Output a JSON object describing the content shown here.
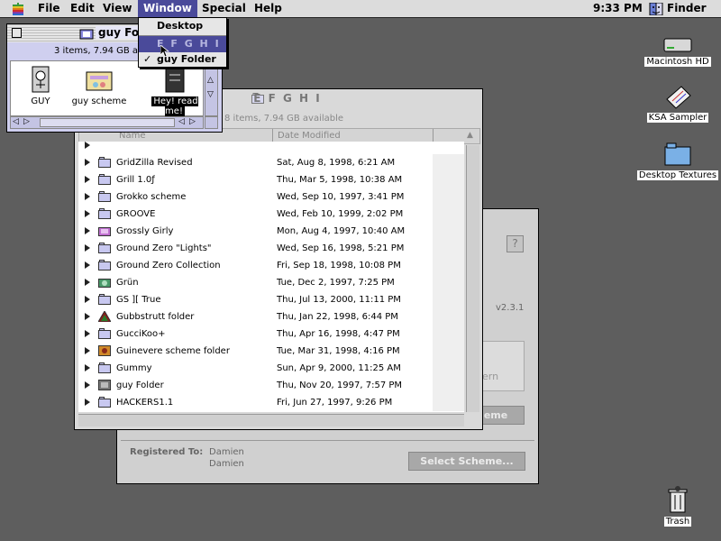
{
  "menubar": {
    "apple": "apple-icon",
    "items": [
      "File",
      "Edit",
      "View",
      "Window",
      "Special",
      "Help"
    ],
    "active": "Window",
    "clock": "9:33 PM",
    "app_name": "Finder"
  },
  "window_menu": {
    "items": [
      {
        "label": "Desktop",
        "checked": false,
        "selected": false
      },
      {
        "label": "E F G H I",
        "checked": false,
        "selected": true
      },
      {
        "label": "guy Folder",
        "checked": true,
        "selected": false
      }
    ],
    "checkmark": "✓"
  },
  "desktop_icons": [
    {
      "label": "Macintosh HD",
      "icon": "hard-drive-icon"
    },
    {
      "label": "KSA Sampler",
      "icon": "document-icon"
    },
    {
      "label": "Desktop Textures",
      "icon": "folder-icon"
    },
    {
      "label": "Trash",
      "icon": "trash-icon"
    }
  ],
  "guy_window": {
    "title": "guy Fold",
    "status": "3 items, 7.94 GB a",
    "items": [
      {
        "label": "GUY",
        "icon": "app-icon"
      },
      {
        "label": "guy scheme",
        "icon": "scheme-icon"
      },
      {
        "label": "Hey! read me!",
        "icon": "readme-icon",
        "selected": true
      }
    ]
  },
  "efghi_window": {
    "title": "E F G H I",
    "status": "8 items, 7.94 GB available",
    "columns": {
      "name": "Name",
      "date": "Date Modified"
    },
    "rows": [
      {
        "name": "GridZilla Revised",
        "date": "Sat, Aug 8, 1998, 6:21 AM",
        "icon": "folder-icon"
      },
      {
        "name": "Grill 1.0ƒ",
        "date": "Thu, Mar 5, 1998, 10:38 AM",
        "icon": "folder-icon"
      },
      {
        "name": "Grokko scheme",
        "date": "Wed, Sep 10, 1997, 3:41 PM",
        "icon": "folder-icon"
      },
      {
        "name": "GROOVE",
        "date": "Wed, Feb 10, 1999, 2:02 PM",
        "icon": "folder-icon"
      },
      {
        "name": "Grossly Girly",
        "date": "Mon, Aug 4, 1997, 10:40 AM",
        "icon": "custom-folder-icon"
      },
      {
        "name": "Ground Zero  \"Lights\"",
        "date": "Wed, Sep 16, 1998, 5:21 PM",
        "icon": "folder-icon"
      },
      {
        "name": "Ground Zero Collection",
        "date": "Fri, Sep 18, 1998, 10:08 PM",
        "icon": "folder-icon"
      },
      {
        "name": "Grün",
        "date": "Tue, Dec 2, 1997, 7:25 PM",
        "icon": "custom-folder-icon"
      },
      {
        "name": "GS ][ True",
        "date": "Thu, Jul 13, 2000, 11:11 PM",
        "icon": "folder-icon"
      },
      {
        "name": "Gubbstrutt folder",
        "date": "Thu, Jan 22, 1998, 6:44 PM",
        "icon": "custom-folder-icon"
      },
      {
        "name": "GucciKoo+",
        "date": "Thu, Apr 16, 1998, 4:47 PM",
        "icon": "folder-icon"
      },
      {
        "name": "Guinevere scheme folder",
        "date": "Tue, Mar 31, 1998, 4:16 PM",
        "icon": "custom-folder-icon"
      },
      {
        "name": "Gummy",
        "date": "Sun, Apr 9, 2000, 11:25 AM",
        "icon": "folder-icon"
      },
      {
        "name": "guy Folder",
        "date": "Thu, Nov 20, 1997, 7:57 PM",
        "icon": "custom-folder-icon"
      },
      {
        "name": "HACKERS1.1",
        "date": "Fri, Jun 27, 1997, 9:26 PM",
        "icon": "folder-icon"
      }
    ]
  },
  "registration_window": {
    "help": "?",
    "version": "v2.3.1",
    "partial_text": "ern",
    "partial_button": "heme",
    "registered_label": "Registered To:",
    "registered_name1": "Damien",
    "registered_name2": "Damien",
    "select_button": "Select Scheme..."
  }
}
